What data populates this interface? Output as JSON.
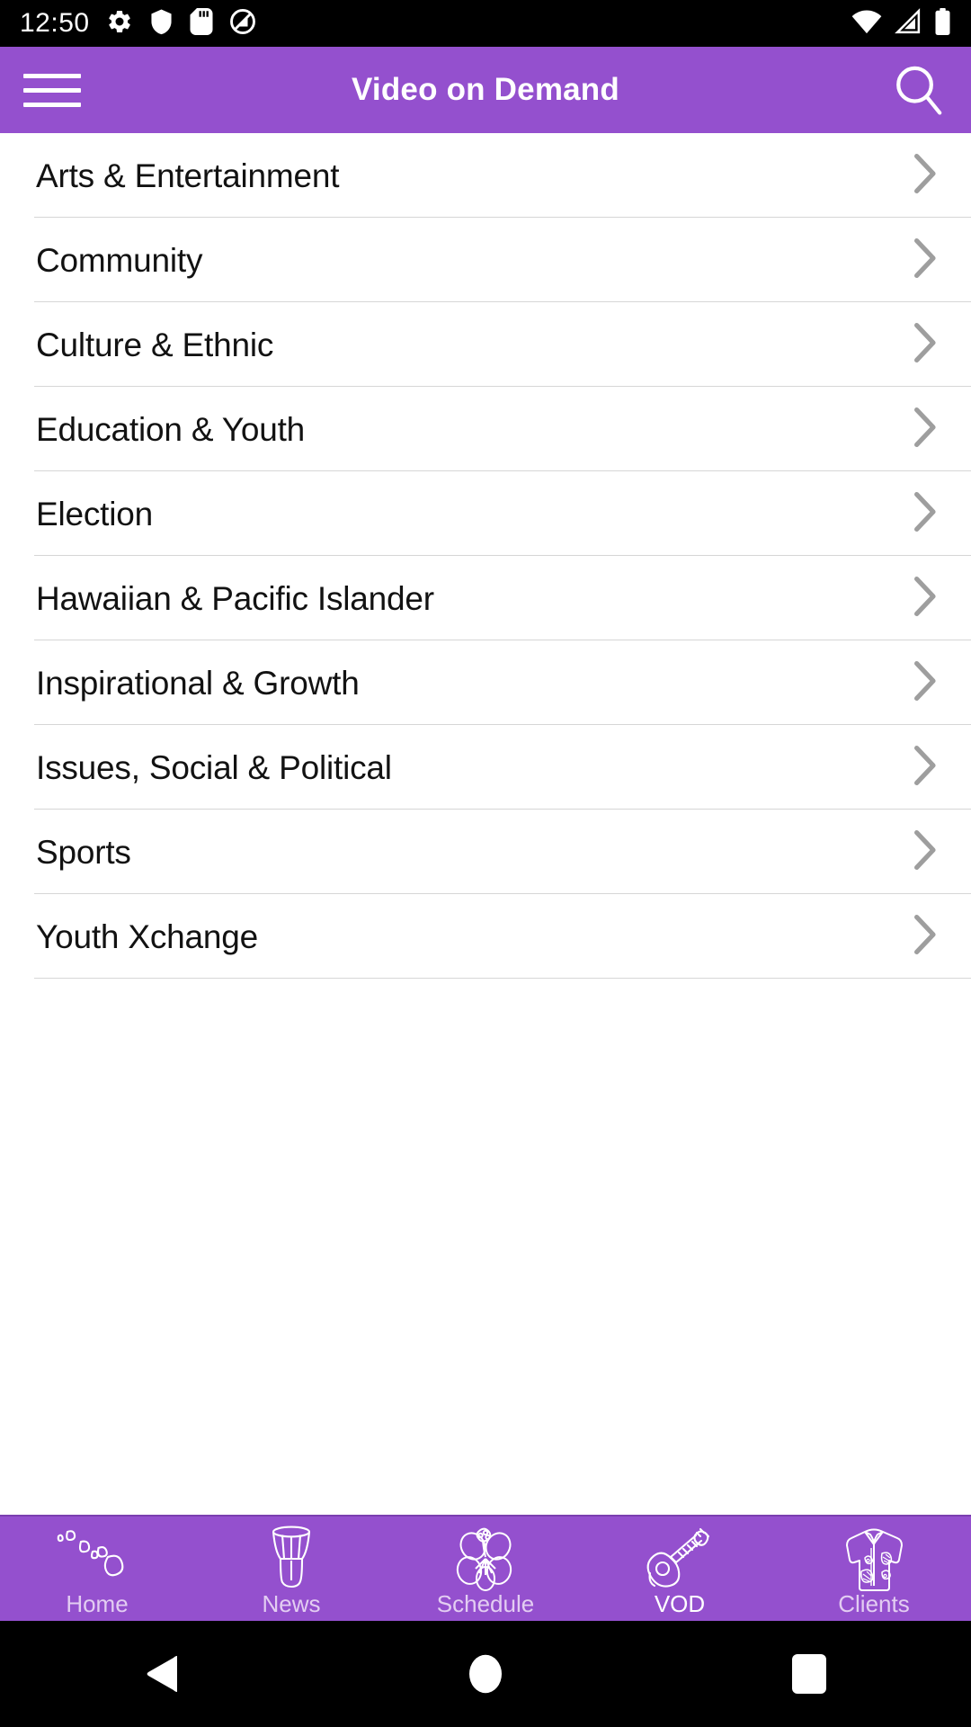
{
  "status_bar": {
    "time": "12:50",
    "left_icons": [
      "settings-gear-icon",
      "shield-icon",
      "sd-card-icon",
      "silent-mode-icon"
    ],
    "right_icons": [
      "wifi-icon",
      "cellular-signal-icon",
      "battery-icon"
    ]
  },
  "app_bar": {
    "title": "Video on Demand",
    "menu_icon": "hamburger-menu-icon",
    "search_icon": "search-icon",
    "background_color": "#9450CE"
  },
  "categories": [
    {
      "label": "Arts & Entertainment"
    },
    {
      "label": "Community"
    },
    {
      "label": "Culture & Ethnic"
    },
    {
      "label": "Education & Youth"
    },
    {
      "label": "Election"
    },
    {
      "label": "Hawaiian & Pacific Islander"
    },
    {
      "label": "Inspirational & Growth"
    },
    {
      "label": "Issues, Social & Political"
    },
    {
      "label": "Sports"
    },
    {
      "label": "Youth Xchange"
    }
  ],
  "bottom_nav": {
    "items": [
      {
        "label": "Home",
        "icon": "hawaiian-islands-icon",
        "active": false
      },
      {
        "label": "News",
        "icon": "ipu-drum-icon",
        "active": false
      },
      {
        "label": "Schedule",
        "icon": "hibiscus-flower-icon",
        "active": false
      },
      {
        "label": "VOD",
        "icon": "ukulele-icon",
        "active": true
      },
      {
        "label": "Clients",
        "icon": "aloha-shirt-icon",
        "active": false
      }
    ],
    "active_color": "#FFFFFF",
    "inactive_color": "#E3CDF2"
  },
  "system_nav": {
    "back": "back-triangle-icon",
    "home": "home-circle-icon",
    "recents": "recents-square-icon"
  },
  "colors": {
    "accent_purple": "#9450CE",
    "list_text": "#121212",
    "divider": "#D6D6D6",
    "chevron": "#9E9E9E"
  }
}
